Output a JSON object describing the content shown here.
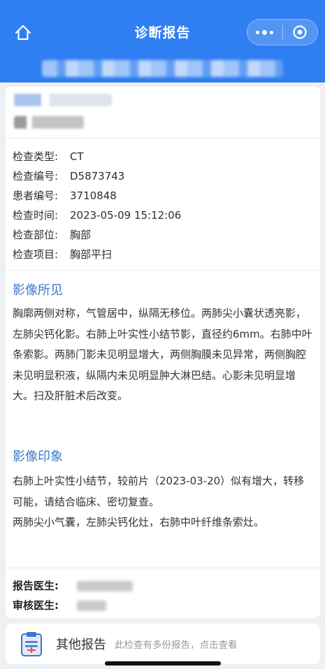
{
  "header": {
    "title": "诊断报告",
    "bg_color": "#2f7ef2",
    "home_icon": "home-icon",
    "more_icon": "more-dots-icon",
    "close_icon": "target-close-icon"
  },
  "patient": {
    "info_rows": [
      {
        "label": "检查类型:",
        "value": "CT"
      },
      {
        "label": "检查编号:",
        "value": "D5873743"
      },
      {
        "label": "患者编号:",
        "value": "3710848"
      },
      {
        "label": "检查时间:",
        "value": "2023-05-09 15:12:06"
      },
      {
        "label": "检查部位:",
        "value": "胸部"
      },
      {
        "label": "检查项目:",
        "value": "胸部平扫"
      }
    ]
  },
  "findings": {
    "title": "影像所见",
    "text": "胸廓两侧对称，气管居中，纵隔无移位。两肺尖小囊状透亮影，左肺尖钙化影。右肺上叶实性小结节影，直径约6mm。右肺中叶条索影。两肺门影未见明显增大，两侧胸膜未见异常，两侧胸腔未见明显积液，纵隔内未见明显肿大淋巴结。心影未见明显增大。扫及肝脏术后改变。"
  },
  "impression": {
    "title": "影像印象",
    "paragraphs": [
      "右肺上叶实性小结节，较前片（2023-03-20）似有增大，转移可能，请结合临床、密切复查。",
      "两肺尖小气囊，左肺尖钙化灶，右肺中叶纤维条索灶。"
    ]
  },
  "doctors": {
    "report_label": "报告医生:",
    "review_label": "审核医生:"
  },
  "bottom": {
    "icon": "clipboard-report-icon",
    "label": "其他报告",
    "hint": "此检查有多份报告，点击查看"
  },
  "accent_color": "#3a78c9"
}
